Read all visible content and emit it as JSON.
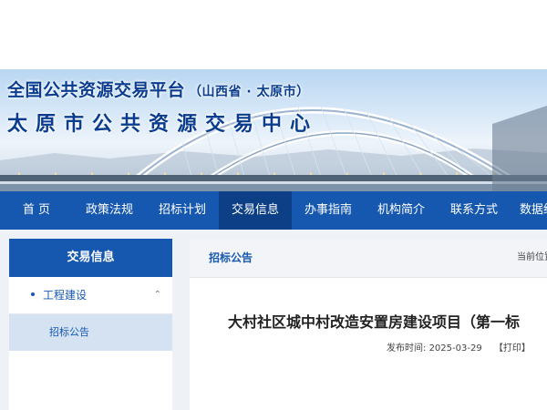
{
  "header": {
    "site_name": "全国公共资源交易平台",
    "region": "（山西省 · 太原市）",
    "center_name": "太原市公共资源交易中心"
  },
  "nav": {
    "items": [
      {
        "label": "首 页"
      },
      {
        "label": "政策法规"
      },
      {
        "label": "招标计划"
      },
      {
        "label": "交易信息",
        "active": true
      },
      {
        "label": "办事指南"
      },
      {
        "label": "机构简介"
      },
      {
        "label": "联系方式"
      },
      {
        "label": "数据统"
      }
    ]
  },
  "sidebar": {
    "title": "交易信息",
    "group": {
      "label": "工程建设",
      "icon": "chevron-up-icon"
    },
    "sub_item": "招标公告"
  },
  "main": {
    "tab": "招标公告",
    "location_label": "当前位置",
    "article": {
      "title": "大村社区城中村改造安置房建设项目（第一标",
      "publish_label": "发布时间:",
      "publish_date": "2025-03-29",
      "print_label": "【打印】"
    }
  },
  "colors": {
    "primary": "#1658b0",
    "nav_active": "#0d3f86",
    "sidebar_sub_bg": "#d4e2f2",
    "page_bg": "#eef1f5"
  }
}
